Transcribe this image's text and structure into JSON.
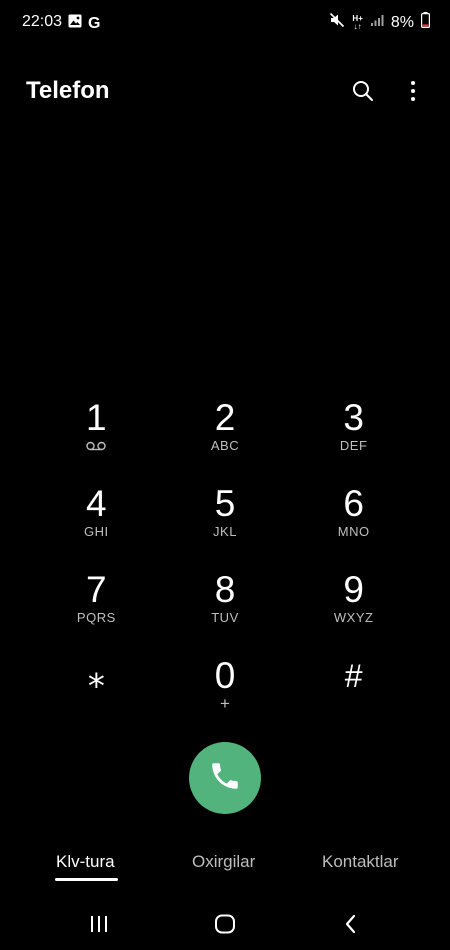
{
  "status_bar": {
    "time": "22:03",
    "battery": "8%",
    "battery_color": "#e53935",
    "icons": [
      "image-icon",
      "google-g-icon",
      "mute-icon",
      "data-hplus-icon",
      "signal-icon",
      "battery-icon"
    ],
    "google_letter": "G",
    "data_label_top": "H+",
    "data_label_bottom": "↓↑"
  },
  "header": {
    "title": "Telefon",
    "actions": [
      "search-icon",
      "more-vert-icon"
    ]
  },
  "keypad": {
    "keys": [
      {
        "digit": "1",
        "letters": "",
        "sub_icon": "voicemail-icon"
      },
      {
        "digit": "2",
        "letters": "ABC"
      },
      {
        "digit": "3",
        "letters": "DEF"
      },
      {
        "digit": "4",
        "letters": "GHI"
      },
      {
        "digit": "5",
        "letters": "JKL"
      },
      {
        "digit": "6",
        "letters": "MNO"
      },
      {
        "digit": "7",
        "letters": "PQRS"
      },
      {
        "digit": "8",
        "letters": "TUV"
      },
      {
        "digit": "9",
        "letters": "WXYZ"
      },
      {
        "digit": "⁎",
        "letters": ""
      },
      {
        "digit": "0",
        "letters": "+"
      },
      {
        "digit": "#",
        "letters": ""
      }
    ]
  },
  "call_button": {
    "icon": "phone-icon",
    "color": "#52b47c"
  },
  "tabs": {
    "items": [
      {
        "label": "Klv-tura",
        "active": true
      },
      {
        "label": "Oxirgilar",
        "active": false
      },
      {
        "label": "Kontaktlar",
        "active": false
      }
    ]
  },
  "navbar": {
    "items": [
      "recents-icon",
      "home-icon",
      "back-icon"
    ]
  }
}
